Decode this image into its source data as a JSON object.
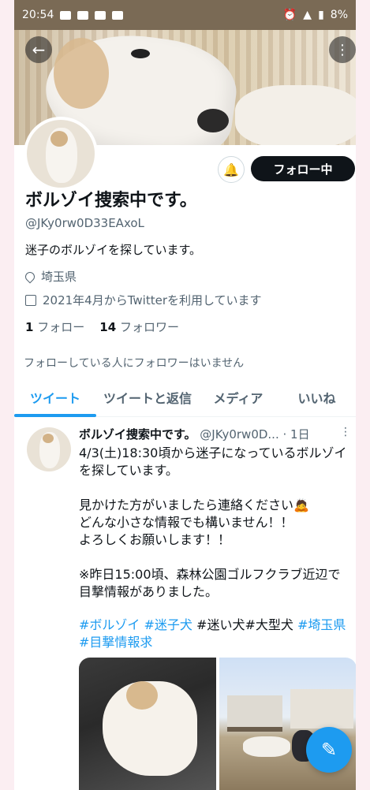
{
  "status_bar": {
    "time": "20:54",
    "battery": "8%"
  },
  "profile": {
    "name": "ボルゾイ捜索中です。",
    "handle": "@JKy0rw0D33EAxoL",
    "bio": "迷子のボルゾイを探しています。",
    "location": "埼玉県",
    "joined": "2021年4月からTwitterを利用しています",
    "following_count": "1",
    "following_label": " フォロー",
    "followers_count": "14",
    "followers_label": " フォロワー",
    "followers_note": "フォローしている人にフォロワーはいません",
    "follow_button": "フォロー中"
  },
  "tabs": [
    "ツイート",
    "ツイートと返信",
    "メディア",
    "いいね"
  ],
  "tweet": {
    "name": "ボルゾイ捜索中です。",
    "handle": "@JKy0rw0D...",
    "time": "· 1日",
    "body": [
      "4/3(土)18:30頃から迷子になっているボルゾイを探しています。",
      "",
      "見かけた方がいましたら連絡ください🙇",
      "どんな小さな情報でも構いません！！",
      "よろしくお願いします！！",
      "",
      "※昨日15:00頃、森林公園ゴルフクラブ近辺で目撃情報がありました。"
    ],
    "tags": [
      "#ボルゾイ",
      "#迷子犬",
      "#迷い犬#大型犬",
      "#埼玉県",
      "#目撃情報求"
    ]
  },
  "colors": {
    "accent": "#1d9bf0",
    "text": "#0f1419",
    "muted": "#536471"
  }
}
